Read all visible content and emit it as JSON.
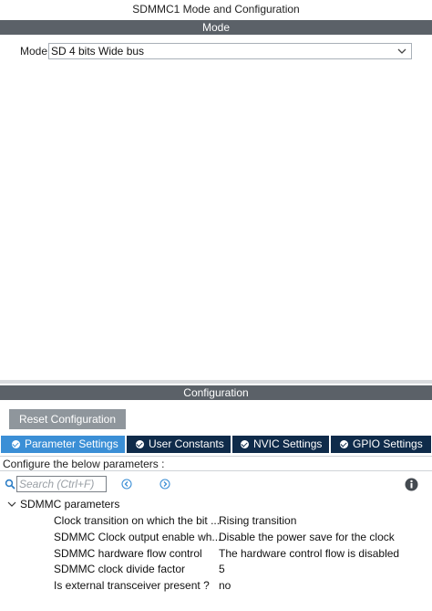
{
  "window": {
    "title": "SDMMC1 Mode and Configuration"
  },
  "mode_section": {
    "header": "Mode",
    "label": "Mode",
    "selected": "SD 4 bits Wide bus"
  },
  "config_section": {
    "header": "Configuration",
    "reset_label": "Reset Configuration",
    "tabs": [
      {
        "label": "Parameter Settings",
        "active": true
      },
      {
        "label": "User Constants",
        "active": false
      },
      {
        "label": "NVIC Settings",
        "active": false
      },
      {
        "label": "GPIO Settings",
        "active": false
      }
    ],
    "hint": "Configure the below parameters :",
    "search": {
      "placeholder": "Search (Ctrl+F)"
    },
    "group": "SDMMC parameters",
    "params": [
      {
        "name": "Clock transition on which the bit ...",
        "value": "Rising transition"
      },
      {
        "name": "SDMMC Clock output enable wh...",
        "value": "Disable the power save for the clock"
      },
      {
        "name": "SDMMC hardware flow control",
        "value": "The hardware control flow is disabled"
      },
      {
        "name": "SDMMC clock divide factor",
        "value": "5"
      },
      {
        "name": "Is external transceiver present ?",
        "value": "no"
      }
    ]
  },
  "colors": {
    "section_bar": "#5b6168",
    "tab_bar": "#0f2b4a",
    "tab_active": "#3b8fd6",
    "reset_button": "#8f969c",
    "nav_arrow": "#3b8fd6"
  },
  "icons": {
    "mode_dropdown": "chevron-down-icon",
    "search": "search-icon",
    "prev": "arrow-left-circle-icon",
    "next": "arrow-right-circle-icon",
    "info": "info-icon",
    "tree_toggle": "chevron-expanded-icon",
    "tab_check": "check-circle-icon"
  }
}
